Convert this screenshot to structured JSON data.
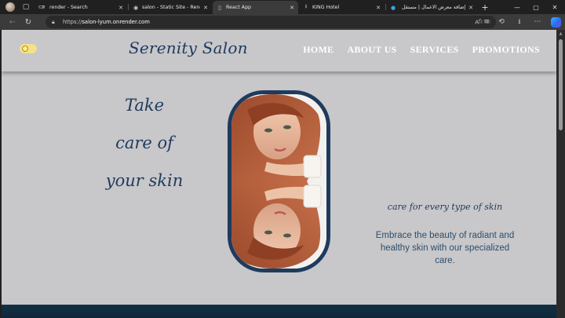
{
  "browser": {
    "tabs": [
      {
        "title": "render - Search",
        "icon": "search-icon",
        "active": false
      },
      {
        "title": "salon - Static Site - Render D",
        "icon": "render-logo-icon",
        "active": false
      },
      {
        "title": "React App",
        "icon": "document-icon",
        "active": true
      },
      {
        "title": "KING Hotel",
        "icon": "download-icon",
        "active": false
      },
      {
        "title": "إضافة معرض الأعمال | مستقل",
        "icon": "site-logo-icon",
        "active": false
      }
    ],
    "address": {
      "scheme": "https://",
      "host": "salon-lyum.onrender.com"
    }
  },
  "site": {
    "brand": "Serenity Salon",
    "nav": [
      "HOME",
      "ABOUT US",
      "SERVICES",
      "PROMOTIONS"
    ],
    "hero_lines": [
      "Take",
      "care of",
      "your skin"
    ],
    "tagline": "care for every type of skin",
    "description": "Embrace the beauty of radiant and healthy skin with our specialized care."
  },
  "colors": {
    "brand": "#1e3b5c",
    "page_bg": "#c8c7ca",
    "toggle": "#f6e08a",
    "footer": "#133145"
  }
}
